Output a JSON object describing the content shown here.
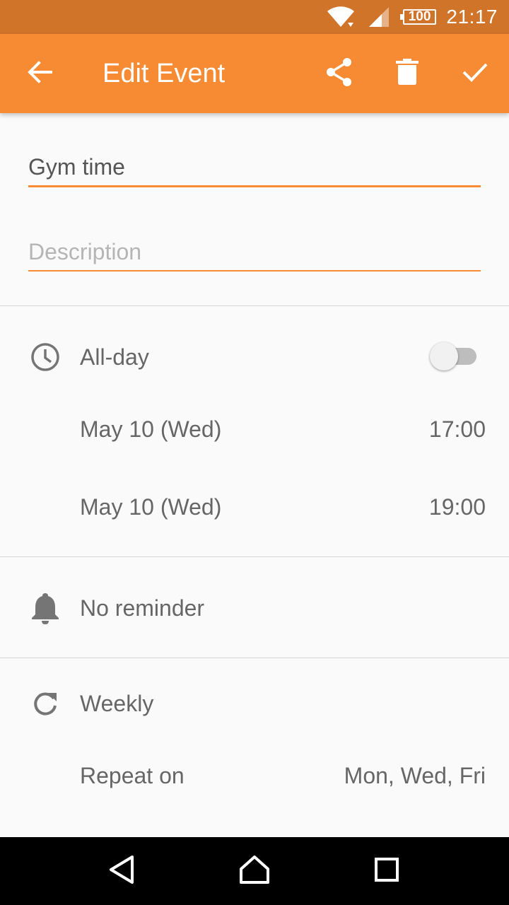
{
  "status_bar": {
    "battery": "100",
    "time": "21:17",
    "icons": [
      "wifi-icon",
      "cell-signal-icon",
      "battery-icon"
    ]
  },
  "app_bar": {
    "title": "Edit Event",
    "actions": [
      "back-arrow-icon",
      "share-icon",
      "delete-icon",
      "check-icon"
    ]
  },
  "form": {
    "title_value": "Gym time",
    "description_placeholder": "Description"
  },
  "time": {
    "all_day_label": "All-day",
    "all_day_on": false,
    "start_date": "May 10 (Wed)",
    "start_time": "17:00",
    "end_date": "May 10 (Wed)",
    "end_time": "19:00"
  },
  "reminder": {
    "label": "No reminder"
  },
  "repeat": {
    "frequency": "Weekly",
    "repeat_on_label": "Repeat on",
    "repeat_on_value": "Mon, Wed, Fri"
  },
  "colors": {
    "accent": "#f68b33",
    "status_bar": "#d0742a",
    "background": "#fafafa",
    "text": "#666666"
  },
  "nav_bar": {
    "icons": [
      "back-triangle-icon",
      "home-icon",
      "recents-icon"
    ]
  }
}
